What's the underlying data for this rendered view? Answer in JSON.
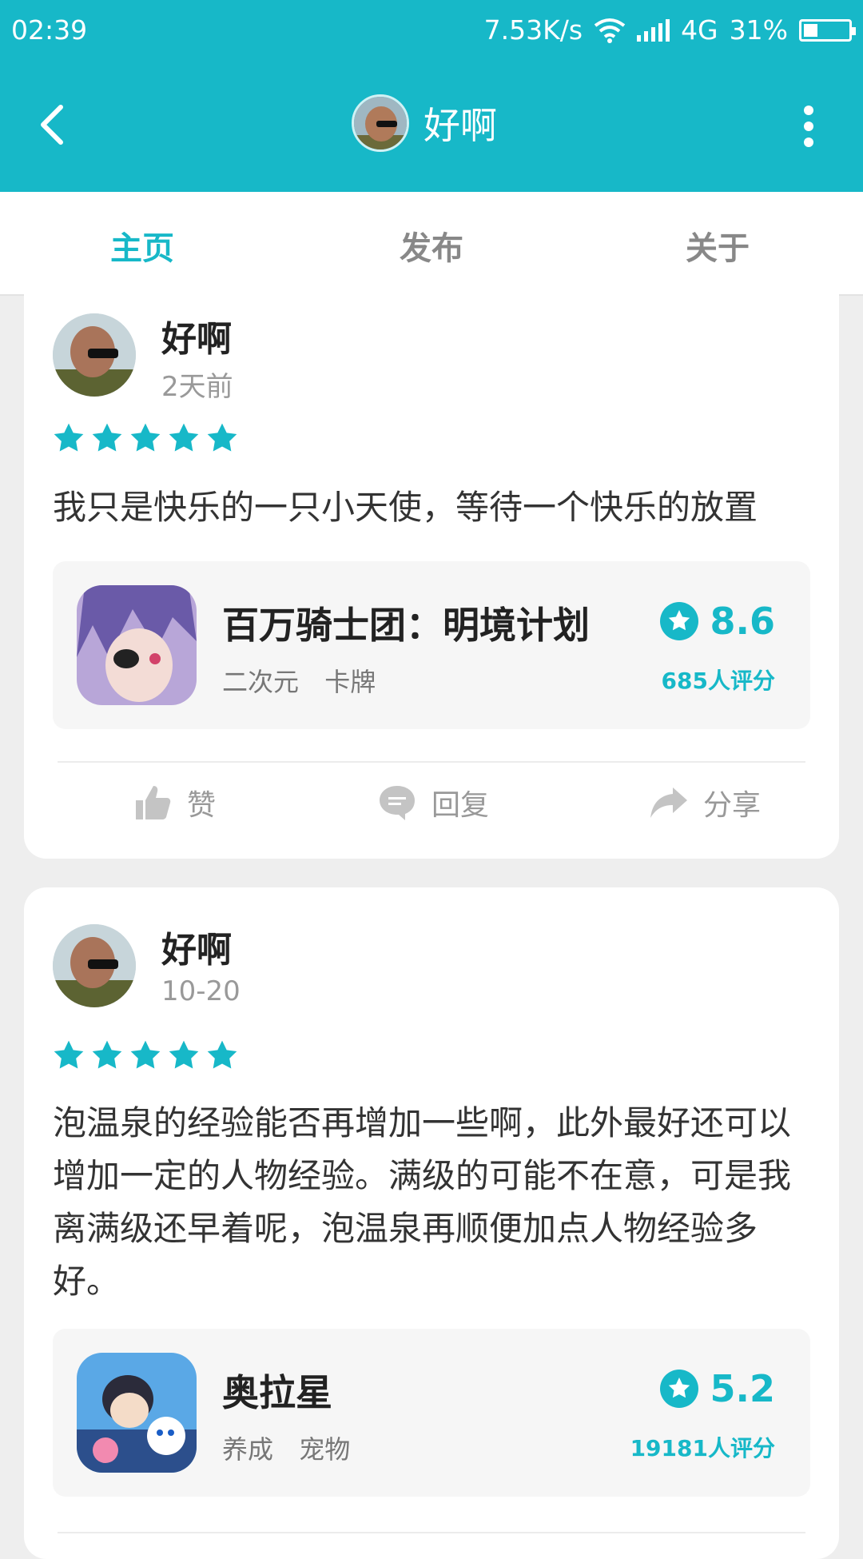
{
  "status_bar": {
    "time": "02:39",
    "speed": "7.53K/s",
    "network": "4G",
    "battery": "31%",
    "battery_level": 0.31
  },
  "header": {
    "title": "好啊"
  },
  "tabs": [
    {
      "label": "主页"
    },
    {
      "label": "发布"
    },
    {
      "label": "关于"
    }
  ],
  "active_tab": 0,
  "posts": [
    {
      "username": "好啊",
      "date": "2天前",
      "stars": 5,
      "text": "我只是快乐的一只小天使，等待一个快乐的放置",
      "game": {
        "name": "百万骑士团：明境计划",
        "tags": [
          "二次元",
          "卡牌"
        ],
        "score": "8.6",
        "raters": "685人评分"
      },
      "actions": {
        "like": "赞",
        "reply": "回复",
        "share": "分享"
      }
    },
    {
      "username": "好啊",
      "date": "10-20",
      "stars": 5,
      "text": "泡温泉的经验能否再增加一些啊，此外最好还可以增加一定的人物经验。满级的可能不在意，可是我离满级还早着呢，泡温泉再顺便加点人物经验多好。",
      "game": {
        "name": "奥拉星",
        "tags": [
          "养成",
          "宠物"
        ],
        "score": "5.2",
        "raters": "19181人评分"
      }
    }
  ],
  "colors": {
    "accent": "#17b8c8",
    "background": "#eeeeee"
  }
}
